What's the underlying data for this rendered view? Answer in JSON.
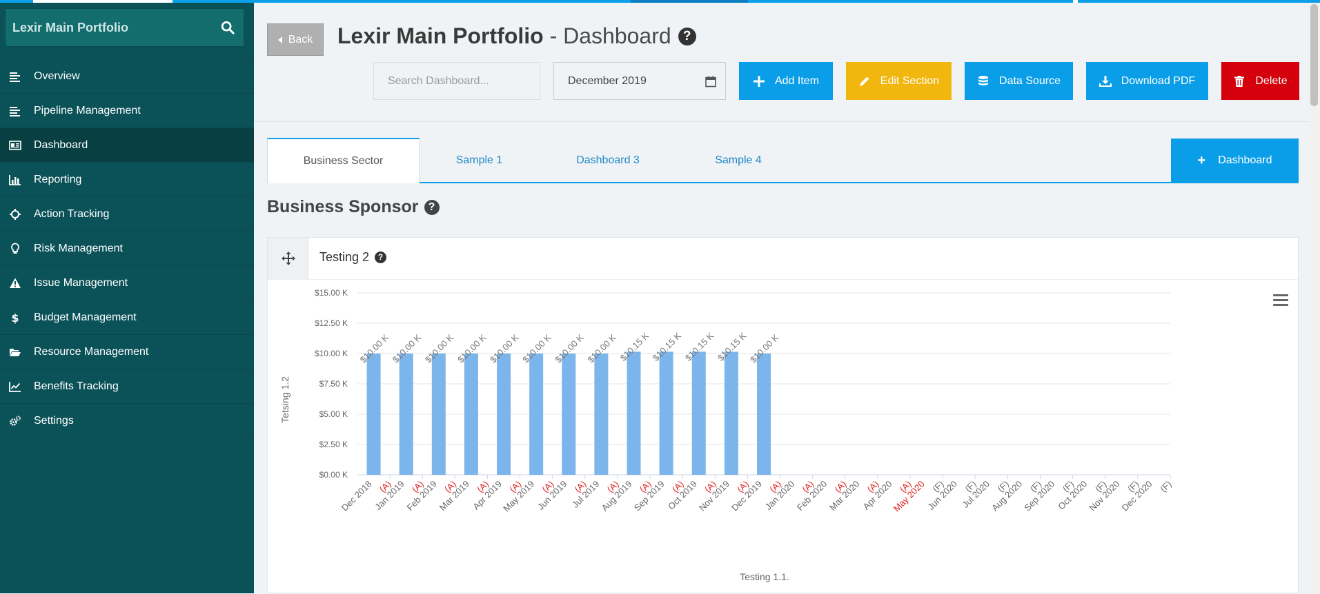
{
  "sidebar": {
    "brand": "Lexir Main Portfolio",
    "items": [
      {
        "label": "Overview",
        "icon": "list-icon"
      },
      {
        "label": "Pipeline Management",
        "icon": "list-icon"
      },
      {
        "label": "Dashboard",
        "icon": "newspaper-icon",
        "active": true
      },
      {
        "label": "Reporting",
        "icon": "bar-chart-icon"
      },
      {
        "label": "Action Tracking",
        "icon": "crosshair-icon"
      },
      {
        "label": "Risk Management",
        "icon": "lightbulb-icon"
      },
      {
        "label": "Issue Management",
        "icon": "warning-icon"
      },
      {
        "label": "Budget Management",
        "icon": "dollar-icon"
      },
      {
        "label": "Resource Management",
        "icon": "folder-open-icon"
      },
      {
        "label": "Benefits Tracking",
        "icon": "line-chart-icon"
      },
      {
        "label": "Settings",
        "icon": "cogs-icon"
      }
    ]
  },
  "header": {
    "back_label": "Back",
    "title_bold": "Lexir Main Portfolio",
    "title_light": " - Dashboard",
    "search_placeholder": "Search Dashboard...",
    "month": "December 2019",
    "buttons": {
      "add_item": "Add Item",
      "edit_section": "Edit Section",
      "data_source": "Data Source",
      "download_pdf": "Download PDF",
      "delete": "Delete"
    }
  },
  "tabs": [
    {
      "label": "Business Sector",
      "active": true
    },
    {
      "label": "Sample 1"
    },
    {
      "label": "Dashboard 3"
    },
    {
      "label": "Sample 4"
    }
  ],
  "add_dashboard_label": "Dashboard",
  "section": {
    "title": "Business Sponsor"
  },
  "card": {
    "title": "Testing 2"
  },
  "colors": {
    "sidebar_bg": "#0b5258",
    "accent_blue": "#0a9ee8",
    "edit_yellow": "#f1b70f",
    "delete_red": "#d4000b",
    "bar": "#7cb5ec",
    "forecast_red": "#e0201f"
  },
  "chart_data": {
    "type": "bar",
    "xlabel": "Testing 1.1.",
    "ylabel": "Tetsing 1.2",
    "ylim": [
      0,
      15000
    ],
    "yticks": [
      "$0.00 K",
      "$2.50 K",
      "$5.00 K",
      "$7.50 K",
      "$10.00 K",
      "$12.50 K",
      "$15.00 K"
    ],
    "grid": true,
    "categories": [
      "Dec 2018",
      "(A)",
      "Jan 2019",
      "(A)",
      "Feb 2019",
      "(A)",
      "Mar 2019",
      "(A)",
      "Apr 2019",
      "(A)",
      "May 2019",
      "(A)",
      "Jun 2019",
      "(A)",
      "Jul 2019",
      "(A)",
      "Aug 2019",
      "(A)",
      "Sep 2019",
      "(A)",
      "Oct 2019",
      "(A)",
      "Nov 2019",
      "(A)",
      "Dec 2019",
      "(A)",
      "Jan 2020",
      "(A)",
      "Feb 2020",
      "(A)",
      "Mar 2020",
      "(A)",
      "Apr 2020",
      "(A)",
      "May 2020",
      "(F)",
      "Jun 2020",
      "(F)",
      "Jul 2020",
      "(F)",
      "Aug 2020",
      "(F)",
      "Sep 2020",
      "(F)",
      "Oct 2020",
      "(F)",
      "Nov 2020",
      "(F)",
      "Dec 2020",
      "(F)"
    ],
    "category_colors": [
      "gray",
      "red",
      "gray",
      "red",
      "gray",
      "red",
      "gray",
      "red",
      "gray",
      "red",
      "gray",
      "red",
      "gray",
      "red",
      "gray",
      "red",
      "gray",
      "red",
      "gray",
      "red",
      "gray",
      "red",
      "gray",
      "red",
      "gray",
      "red",
      "gray",
      "red",
      "gray",
      "red",
      "gray",
      "red",
      "gray",
      "red",
      "red",
      "gray",
      "gray",
      "gray",
      "gray",
      "gray",
      "gray",
      "gray",
      "gray",
      "gray",
      "gray",
      "gray",
      "gray",
      "gray",
      "gray",
      "gray"
    ],
    "values": [
      10000,
      10000,
      10000,
      10000,
      10000,
      10000,
      10000,
      10000,
      10150,
      10150,
      10150,
      10150,
      10000
    ],
    "data_labels": [
      "$10.00 K",
      "$10.00 K",
      "$10.00 K",
      "$10.00 K",
      "$10.00 K",
      "$10.00 K",
      "$10.00 K",
      "$10.00 K",
      "$10.15 K",
      "$10.15 K",
      "$10.15 K",
      "$10.15 K",
      "$10.00 K"
    ]
  }
}
